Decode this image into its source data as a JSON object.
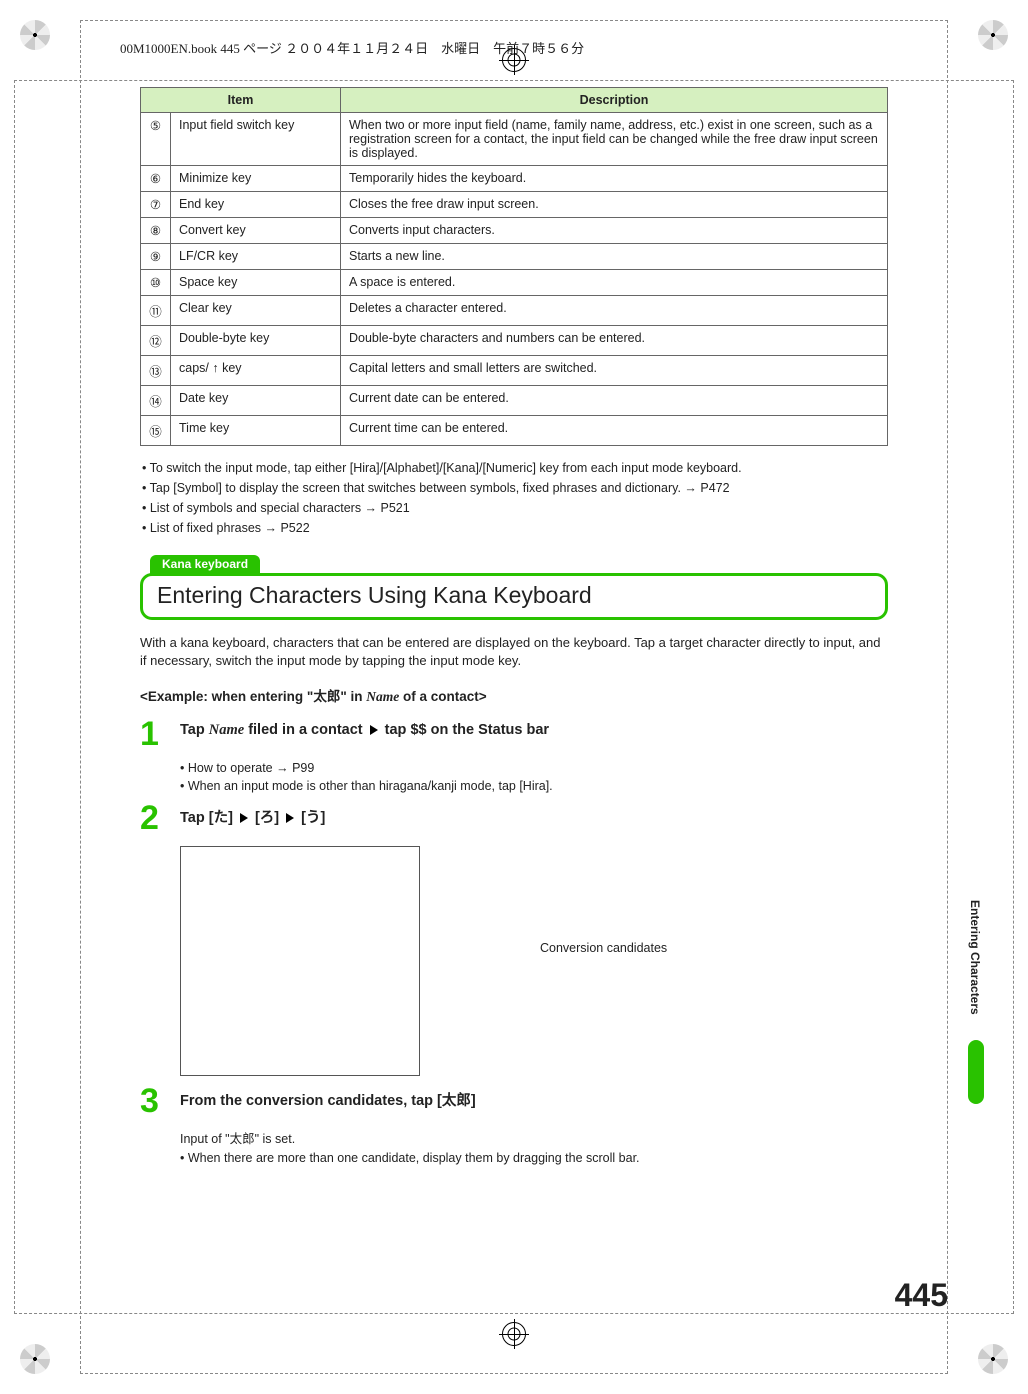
{
  "header": {
    "text": "00M1000EN.book  445 ページ  ２００４年１１月２４日　水曜日　午前７時５６分"
  },
  "table": {
    "col_item": "Item",
    "col_desc": "Description",
    "rows": [
      {
        "num": "⑤",
        "item": "Input field switch key",
        "desc": "When two or more input field (name, family name, address, etc.) exist in one screen, such as a registration screen for a contact, the input field can be changed while the free draw input screen is displayed."
      },
      {
        "num": "⑥",
        "item": "Minimize key",
        "desc": "Temporarily hides the keyboard."
      },
      {
        "num": "⑦",
        "item": "End key",
        "desc": "Closes the free draw input screen."
      },
      {
        "num": "⑧",
        "item": "Convert key",
        "desc": "Converts input characters."
      },
      {
        "num": "⑨",
        "item": "LF/CR key",
        "desc": "Starts a new line."
      },
      {
        "num": "⑩",
        "item": "Space key",
        "desc": "A space is entered."
      },
      {
        "num": "⑪",
        "item": "Clear key",
        "desc": "Deletes a character entered."
      },
      {
        "num": "⑫",
        "item": "Double-byte key",
        "desc": "Double-byte characters and numbers can be entered."
      },
      {
        "num": "⑬",
        "item": "caps/ ↑ key",
        "desc": "Capital letters and small letters are switched."
      },
      {
        "num": "⑭",
        "item": "Date key",
        "desc": "Current date can be entered."
      },
      {
        "num": "⑮",
        "item": "Time key",
        "desc": "Current time can be entered."
      }
    ]
  },
  "bullets": [
    "To switch the input mode, tap either [Hira]/[Alphabet]/[Kana]/[Numeric] key from each input mode keyboard.",
    "Tap [Symbol] to display the screen that switches between symbols, fixed phrases and dictionary. → P472",
    "List of symbols and special characters → P521",
    "List of fixed phrases → P522"
  ],
  "section": {
    "tab": "Kana keyboard",
    "title": "Entering Characters Using Kana Keyboard"
  },
  "intro": "With a kana keyboard, characters that can be entered are displayed on the keyboard. Tap a target character directly to input, and if necessary, switch the input mode by tapping the input mode key.",
  "example_prefix": "<Example: when entering \"",
  "example_name": "太郎",
  "example_mid": "\" in ",
  "example_italic": "Name",
  "example_suffix": " of a contact>",
  "step1": {
    "num": "1",
    "a": "Tap ",
    "italic": "Name",
    "b": " filed in a contact ",
    "c": " tap $$ on the Status bar",
    "sub1": "How to operate → P99",
    "sub2": "When an input mode is other than hiragana/kanji mode, tap [Hira]."
  },
  "step2": {
    "num": "2",
    "a": "Tap [",
    "k1": "た",
    "b": "] ",
    "c": " [",
    "k2": "ろ",
    "d": "] ",
    "e": " [",
    "k3": "う",
    "f": "]",
    "candidates": "Conversion candidates"
  },
  "step3": {
    "num": "3",
    "a": "From the conversion candidates, tap [",
    "k": "太郎",
    "b": "]",
    "sub0a": "Input of \"",
    "sub0k": "太郎",
    "sub0b": "\" is set.",
    "sub1": "When there are more than one candidate, display them by dragging the scroll bar."
  },
  "side_tab": "Entering Characters",
  "page_num": "445"
}
